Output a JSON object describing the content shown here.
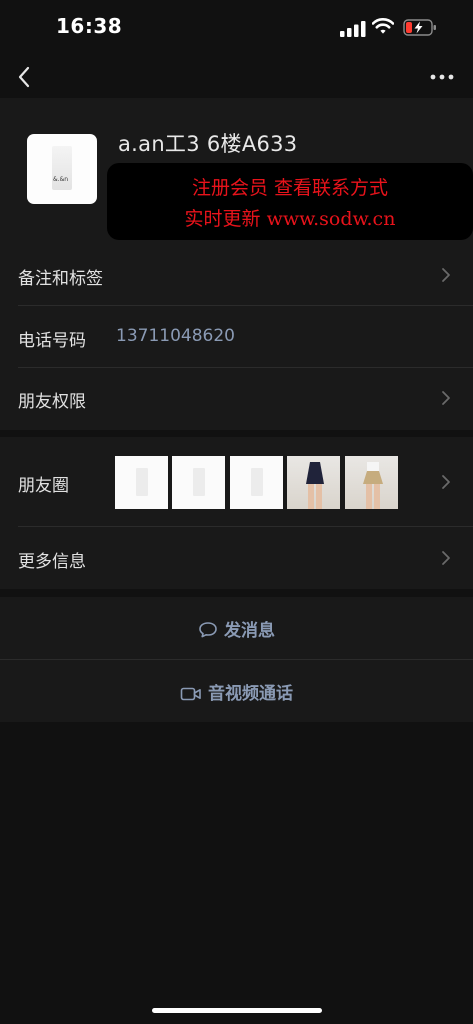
{
  "status_bar": {
    "time": "16:38"
  },
  "profile": {
    "nickname": "a.an工3  6楼A633",
    "avatar_logo_text": "&.&n",
    "banner": {
      "line1": "注册会员 查看联系方式",
      "line2": "实时更新 www.sodw.cn"
    }
  },
  "rows": {
    "remarks_label": "备注和标签",
    "phone_label": "电话号码",
    "phone_value": "13711048620",
    "permissions_label": "朋友权限",
    "moments_label": "朋友圈",
    "more_info_label": "更多信息"
  },
  "actions": {
    "message_label": "发消息",
    "call_label": "音视频通话"
  },
  "colors": {
    "background": "#111111",
    "card": "#191919",
    "link": "#8a9ab4",
    "banner_text": "#e8131b"
  },
  "icons": [
    "back-icon",
    "more-icon",
    "signal-icon",
    "wifi-icon",
    "battery-icon",
    "chevron-right-icon",
    "chat-bubble-icon",
    "video-camera-icon"
  ]
}
